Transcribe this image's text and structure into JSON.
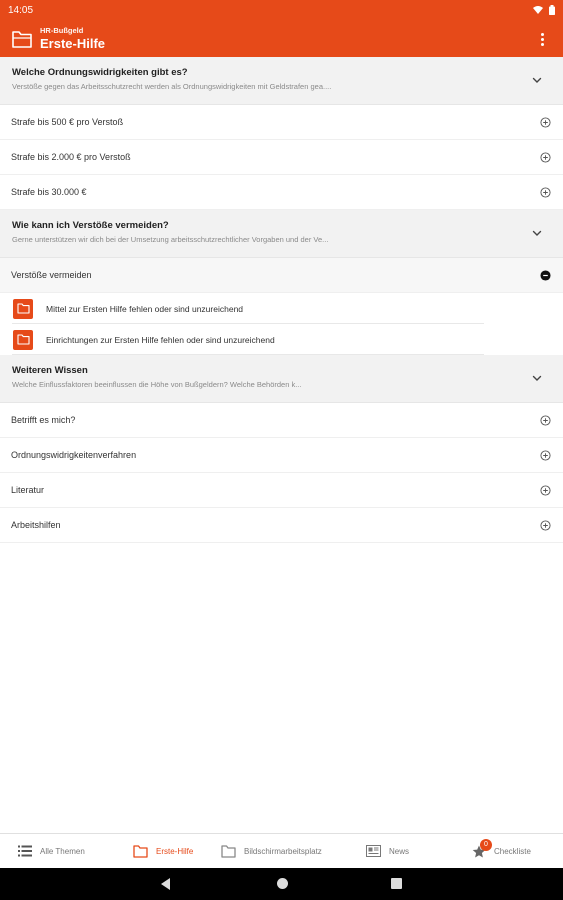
{
  "status_bar": {
    "time": "14:05"
  },
  "app_bar": {
    "subtitle": "HR-Bußgeld",
    "title": "Erste-Hilfe"
  },
  "colors": {
    "accent": "#e64a19",
    "section_bg": "#f2f2f2"
  },
  "sections": [
    {
      "title": "Welche Ordnungswidrigkeiten gibt es?",
      "subtitle": "Verstöße gegen das Arbeitsschutzrecht werden als Ordnungswidrigkeiten mit Geldstrafen gea....",
      "rows": [
        "Strafe bis 500 € pro Verstoß",
        "Strafe bis 2.000 € pro Verstoß",
        "Strafe bis 30.000 €"
      ]
    },
    {
      "title": "Wie kann ich Verstöße vermeiden?",
      "subtitle": "Gerne unterstützen wir dich bei der Umsetzung arbeitsschutzrechtlicher Vorgaben und der Ve...",
      "expanded_row": "Verstöße vermeiden",
      "documents": [
        "Mittel zur Ersten Hilfe fehlen oder sind unzureichend",
        "Einrichtungen zur Ersten Hilfe fehlen oder sind unzureichend"
      ]
    },
    {
      "title": "Weiteren Wissen",
      "subtitle": "Welche Einflussfaktoren beeinflussen die Höhe von Bußgeldern? Welche Behörden k...",
      "rows": [
        "Betrifft es mich?",
        "Ordnungswidrigkeitenverfahren",
        "Literatur",
        "Arbeitshilfen"
      ]
    }
  ],
  "bottom_nav": [
    {
      "label": "Alle Themen",
      "icon": "list-icon"
    },
    {
      "label": "Erste-Hilfe",
      "icon": "folder-icon",
      "active": true
    },
    {
      "label": "Bildschirmarbeitsplatz",
      "icon": "folder-icon"
    },
    {
      "label": "News",
      "icon": "newspaper-icon"
    },
    {
      "label": "Checkliste",
      "icon": "star-icon",
      "badge": "0"
    }
  ]
}
